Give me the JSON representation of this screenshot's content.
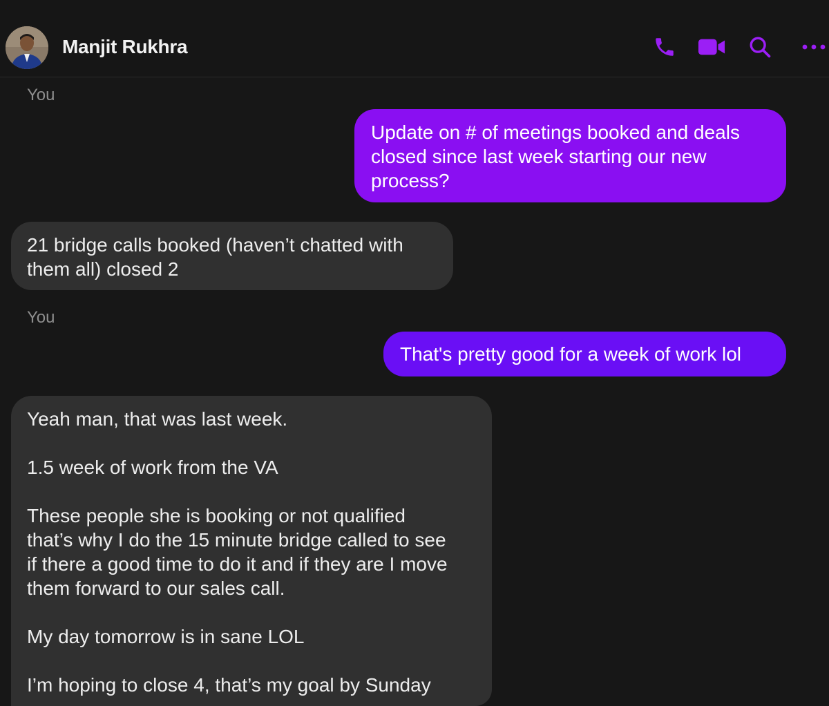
{
  "header": {
    "contact_name": "Manjit Rukhra",
    "icons": [
      "phone-icon",
      "video-camera-icon",
      "search-icon",
      "more-options-icon"
    ],
    "accent_color": "#9b1ff5"
  },
  "thread": {
    "messages": [
      {
        "sender_label": "You"
      },
      {
        "direction": "outgoing",
        "text": "Update on # of meetings booked and deals\nclosed since last week starting our new\nprocess?",
        "color": "#8a0ff2"
      },
      {
        "direction": "incoming",
        "text": "21 bridge calls booked (haven’t chatted with\nthem all) closed 2"
      },
      {
        "sender_label": "You"
      },
      {
        "direction": "outgoing",
        "text": "That's pretty good for a week of work lol",
        "color": "#6a0ff5"
      },
      {
        "direction": "incoming",
        "text": "Yeah man, that was last week.\n\n1.5 week of work from the VA\n\nThese people she is booking or not qualified\nthat’s why I do the 15 minute bridge called to see\nif there a good time to do it and if they are I move\nthem forward to our sales call.\n\nMy day tomorrow is in sane LOL\n\nI’m hoping to close 4, that’s my goal by Sunday"
      }
    ]
  }
}
